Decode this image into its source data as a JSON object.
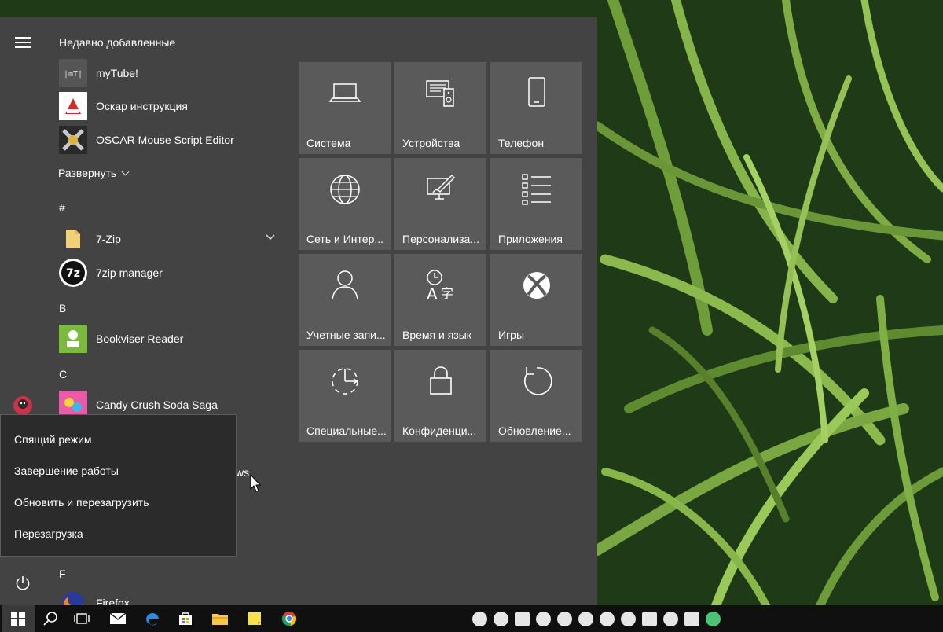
{
  "app_list": {
    "recent_title": "Недавно добавленные",
    "recent": [
      {
        "label": "myTube!"
      },
      {
        "label": "Оскар инструкция"
      },
      {
        "label": "OSCAR Mouse Script Editor"
      }
    ],
    "expand_label": "Развернуть",
    "groups": [
      {
        "letter": "#",
        "items": [
          {
            "label": "7-Zip"
          },
          {
            "label": "7zip manager"
          }
        ]
      },
      {
        "letter": "B",
        "items": [
          {
            "label": "Bookviser Reader"
          }
        ]
      },
      {
        "letter": "C",
        "items": [
          {
            "label": "Candy Crush Soda Saga"
          }
        ]
      },
      {
        "letter": "F",
        "items": [
          {
            "label": "Firefox"
          }
        ]
      }
    ],
    "obscured_fragment": "ws"
  },
  "tiles": [
    {
      "label": "Система",
      "icon": "laptop-icon"
    },
    {
      "label": "Устройства",
      "icon": "devices-icon"
    },
    {
      "label": "Телефон",
      "icon": "phone-icon"
    },
    {
      "label": "Сеть и Интер...",
      "icon": "globe-icon"
    },
    {
      "label": "Персонализа...",
      "icon": "personalization-icon"
    },
    {
      "label": "Приложения",
      "icon": "apps-list-icon"
    },
    {
      "label": "Учетные запи...",
      "icon": "person-icon"
    },
    {
      "label": "Время и язык",
      "icon": "time-language-icon"
    },
    {
      "label": "Игры",
      "icon": "xbox-icon"
    },
    {
      "label": "Специальные...",
      "icon": "accessibility-icon"
    },
    {
      "label": "Конфиденци...",
      "icon": "lock-icon"
    },
    {
      "label": "Обновление...",
      "icon": "update-icon"
    }
  ],
  "power_menu": {
    "items": [
      {
        "label": "Спящий режим"
      },
      {
        "label": "Завершение работы"
      },
      {
        "label": "Обновить и перезагрузить"
      },
      {
        "label": "Перезагрузка"
      }
    ]
  },
  "colors": {
    "menu_bg": "#434343",
    "tile_bg": "#5a5a5a",
    "power_menu_bg": "#2b2b2b",
    "taskbar_bg": "#101010"
  }
}
